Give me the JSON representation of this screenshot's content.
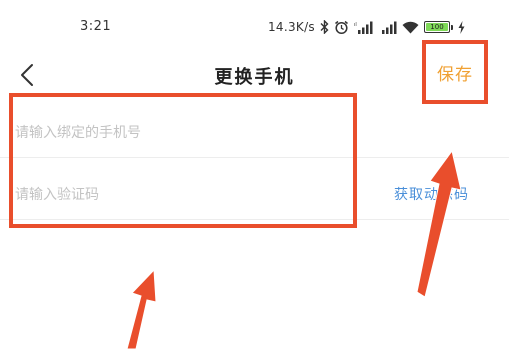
{
  "status_bar": {
    "time": "3:21",
    "speed": "14.3K/s",
    "battery_level": "100",
    "battery_color": "#7ed957"
  },
  "nav": {
    "title": "更换手机",
    "save_label": "保存",
    "save_color": "#f0a032"
  },
  "form": {
    "phone_placeholder": "请输入绑定的手机号",
    "code_placeholder": "请输入验证码",
    "get_code_label": "获取动态码"
  },
  "annotation_color": "#e94e2c",
  "link_color": "#4a8fd9",
  "icons": [
    "back-arrow-icon",
    "bluetooth-icon",
    "alarm-icon",
    "signal-icon",
    "wifi-icon",
    "battery-icon",
    "charging-icon"
  ]
}
